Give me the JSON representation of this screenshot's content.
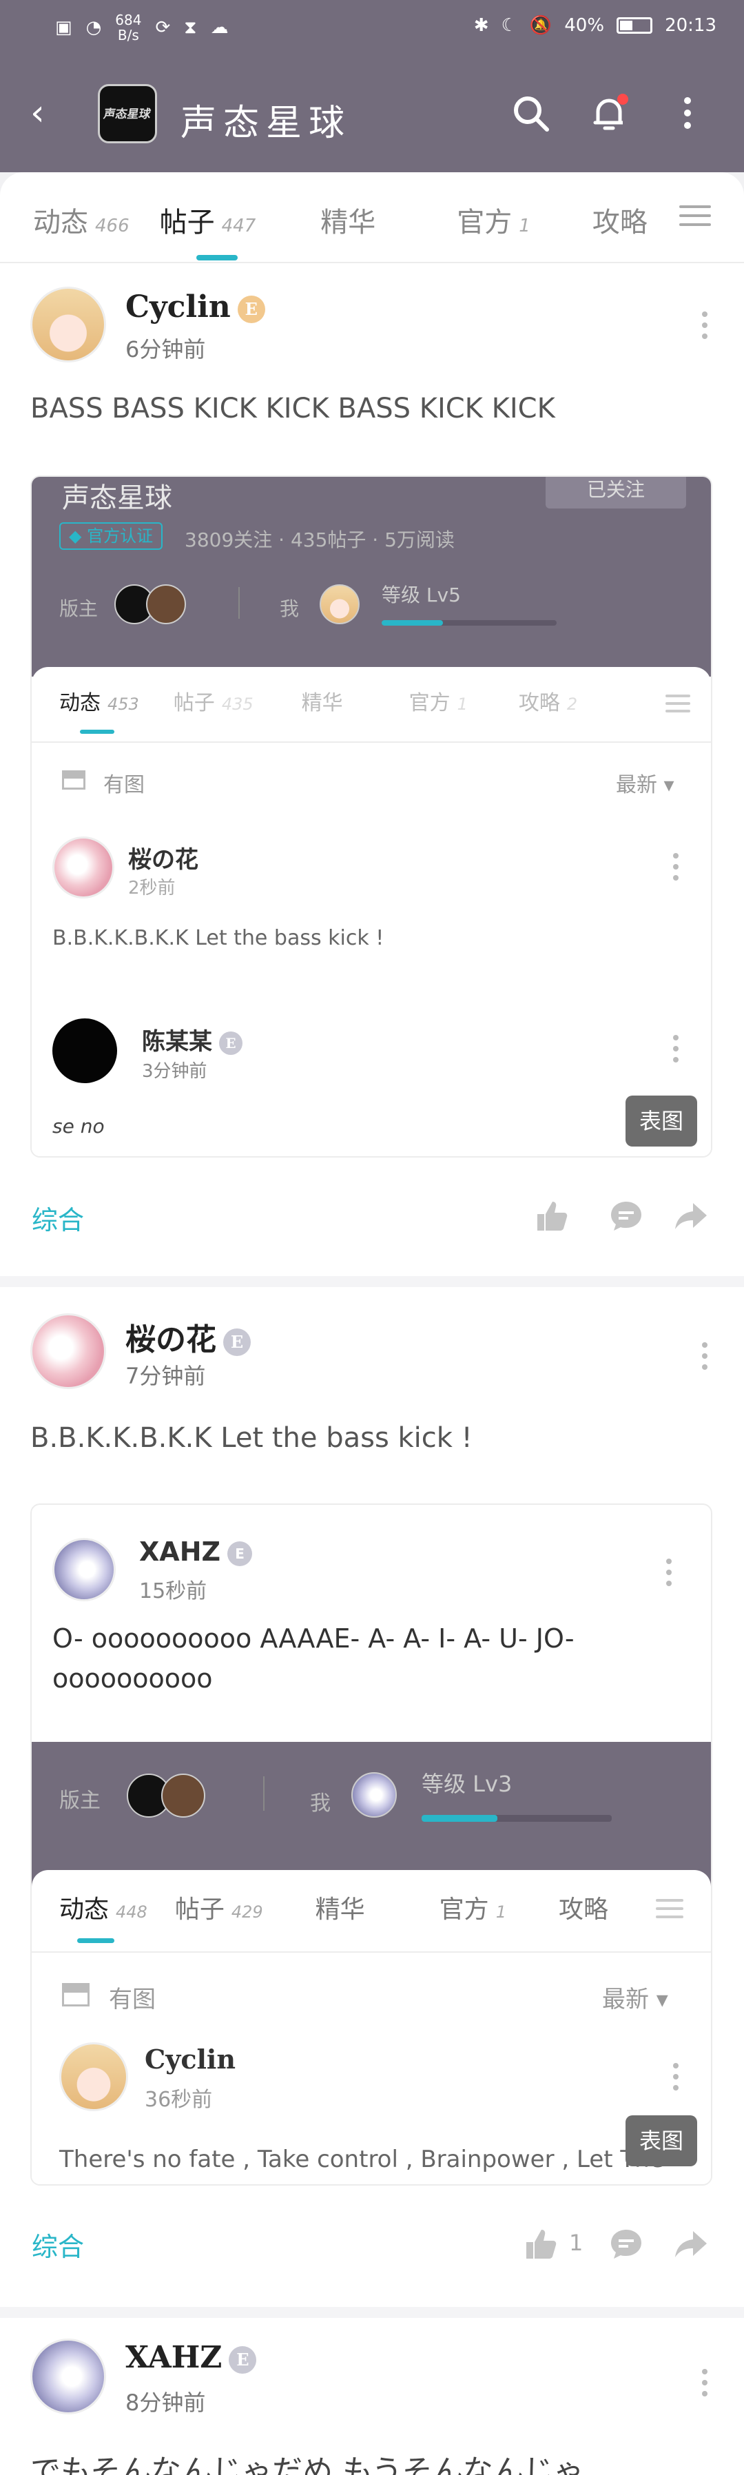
{
  "status": {
    "speed_num": "684",
    "speed_unit": "B/s",
    "battery": "40%",
    "time": "20:13"
  },
  "nav": {
    "title": "声态星球",
    "logo_text": "声态星球"
  },
  "tabs": [
    {
      "label": "动态",
      "count": "466"
    },
    {
      "label": "帖子",
      "count": "447"
    },
    {
      "label": "精华",
      "count": ""
    },
    {
      "label": "官方",
      "count": "1"
    },
    {
      "label": "攻略",
      "count": ""
    }
  ],
  "post1": {
    "author": "Cyclin",
    "badge": "E",
    "time": "6分钟前",
    "text": "BASS BASS KICK KICK BASS KICK KICK",
    "embed": {
      "header": "声态星球",
      "follow": "已关注",
      "official": "官方认证",
      "stats": "3809关注 · 435帖子 · 5万阅读",
      "owner_label": "版主",
      "me_label": "我",
      "level": "等级 Lv5",
      "level_progress": 0.35,
      "tabs": [
        {
          "label": "动态",
          "count": "453"
        },
        {
          "label": "帖子",
          "count": "435"
        },
        {
          "label": "精华",
          "count": ""
        },
        {
          "label": "官方",
          "count": "1"
        },
        {
          "label": "攻略",
          "count": "2"
        }
      ],
      "sort": "有图",
      "newest": "最新",
      "items": [
        {
          "author": "桜の花",
          "time": "2秒前",
          "text": "B.B.K.K.B.K.K Let the bass kick !"
        },
        {
          "author": "陈某某",
          "badge": "E",
          "time": "3分钟前",
          "text": "se no"
        }
      ],
      "button": "表图"
    },
    "category": "综合"
  },
  "post2": {
    "author": "桜の花",
    "badge": "E",
    "time": "7分钟前",
    "text": "B.B.K.K.B.K.K Let the bass kick !",
    "embed": {
      "author": "XAHZ",
      "badge": "E",
      "time": "15秒前",
      "text_line1": "O- oooooooooo AAAAE- A- A- I- A- U- JO-",
      "text_line2": "oooooooooo",
      "owner_label": "版主",
      "me_label": "我",
      "level": "等级 Lv3",
      "level_progress": 0.4,
      "tabs": [
        {
          "label": "动态",
          "count": "448"
        },
        {
          "label": "帖子",
          "count": "429"
        },
        {
          "label": "精华",
          "count": ""
        },
        {
          "label": "官方",
          "count": "1"
        },
        {
          "label": "攻略",
          "count": ""
        }
      ],
      "sort": "有图",
      "newest": "最新",
      "inner_author": "Cyclin",
      "inner_time": "36秒前",
      "inner_text": "There's no fate , Take control , Brainpower , Let The",
      "button": "表图"
    },
    "category": "综合",
    "like_count": "1"
  },
  "post3": {
    "author": "XAHZ",
    "badge": "E",
    "time": "8分钟前",
    "text": "でもそんなんじゃだめ  もうそんなんじゃ"
  },
  "colors": {
    "accent": "#29b6c8",
    "header": "#736c7c"
  }
}
